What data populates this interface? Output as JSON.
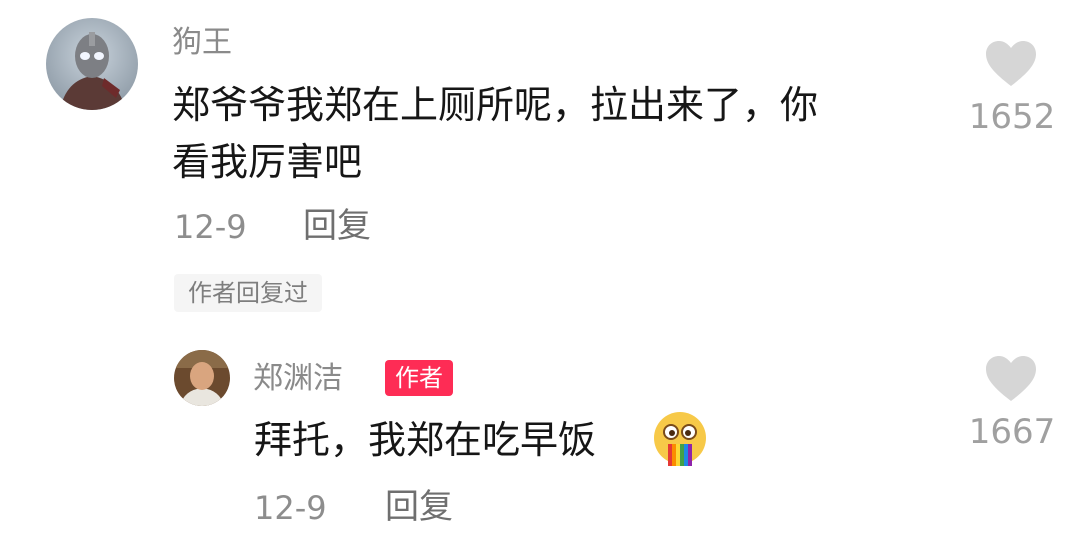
{
  "comments": [
    {
      "username": "狗王",
      "text_line1": "郑爷爷我郑在上厕所呢，拉出来了，你",
      "text_line2": "看我厉害吧",
      "date": "12-9",
      "reply_label": "回复",
      "like_count": "1652",
      "author_replied_tag": "作者回复过"
    }
  ],
  "reply": {
    "username": "郑渊洁",
    "author_badge": "作者",
    "text": "拜托，我郑在吃早饭",
    "date": "12-9",
    "reply_label": "回复",
    "like_count": "1667"
  },
  "colors": {
    "badge_red": "#fe2c55",
    "heart_gray": "#d6d6d6",
    "muted_text": "#8a8a8a",
    "main_text": "#161616"
  },
  "icons": {
    "like": "heart-icon",
    "reply_emoji": "rainbow-puke-emoji-icon"
  }
}
